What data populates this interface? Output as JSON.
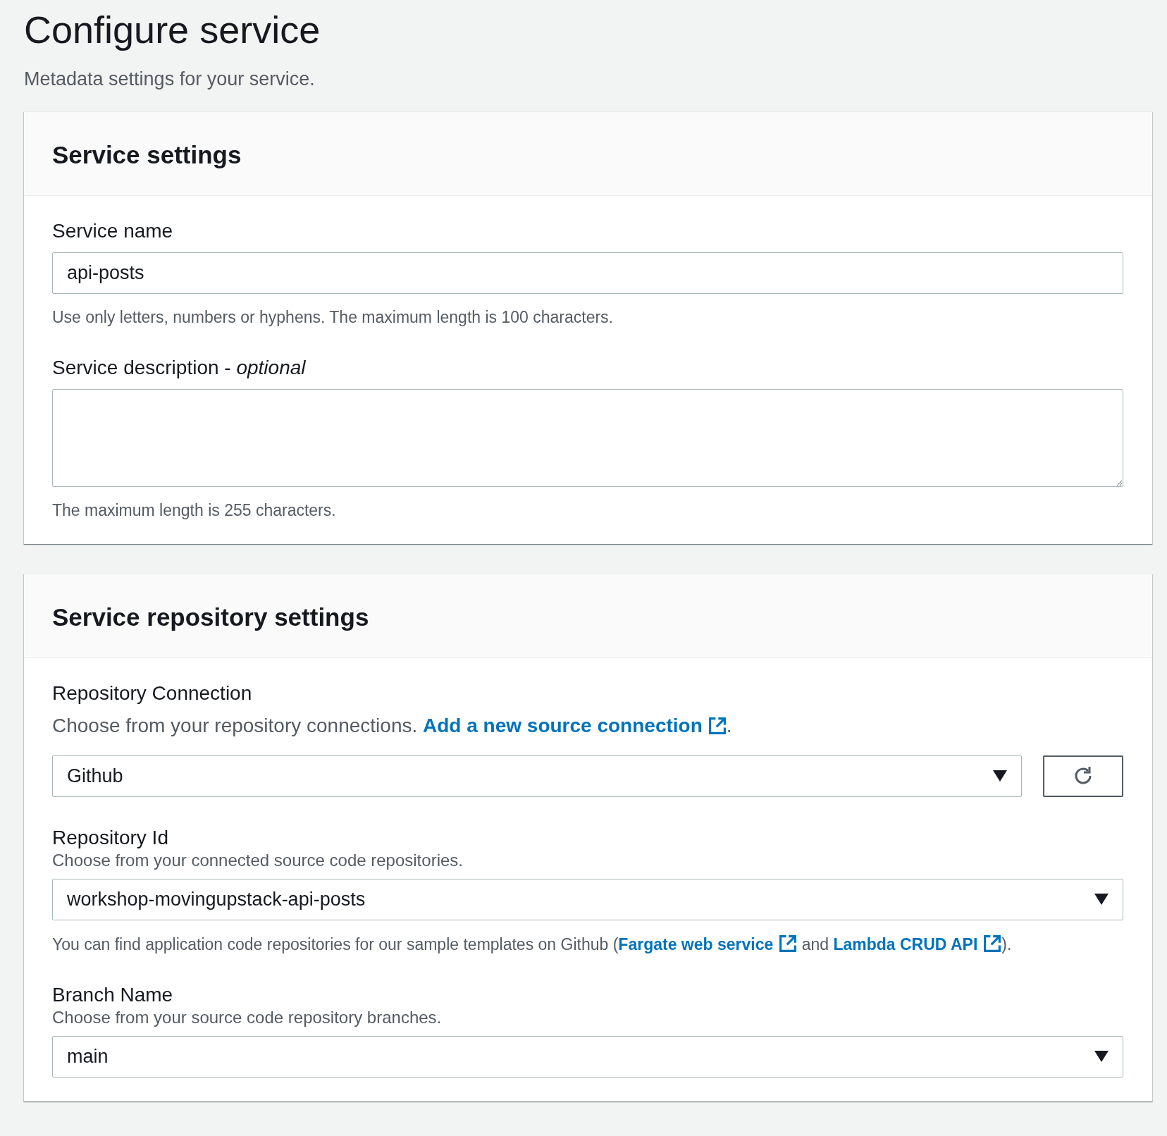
{
  "page": {
    "title": "Configure service",
    "description": "Metadata settings for your service."
  },
  "panels": [
    {
      "title": "Service settings",
      "fields": [
        {
          "kind": "text",
          "label": "Service name",
          "value": "api-posts",
          "hint": [
            {
              "text": "Use only letters, numbers or hyphens. The maximum length is 100 characters."
            }
          ]
        },
        {
          "kind": "textarea",
          "label": "Service description -",
          "label_suffix": "optional",
          "hint": [
            {
              "text": "The maximum length is 255 characters."
            }
          ]
        }
      ]
    },
    {
      "title": "Service repository settings",
      "fields": [
        {
          "kind": "select",
          "label": "Repository Connection",
          "description": [
            {
              "text": "Choose from your repository connections. "
            },
            {
              "text": "Add a new source connection",
              "link": true
            },
            {
              "text": "."
            }
          ],
          "value": "Github",
          "refresh": true
        },
        {
          "kind": "select",
          "label": "Repository Id",
          "description": [
            {
              "text": "Choose from your connected source code repositories."
            }
          ],
          "value": "workshop-movingupstack-api-posts",
          "hint": [
            {
              "text": "You can find application code repositories for our sample templates on Github ("
            },
            {
              "text": "Fargate web service",
              "link": true
            },
            {
              "text": " and "
            },
            {
              "text": "Lambda CRUD API",
              "link": true
            },
            {
              "text": ")."
            }
          ]
        },
        {
          "kind": "select",
          "label": "Branch Name",
          "description": [
            {
              "text": "Choose from your source code repository branches."
            }
          ],
          "value": "main"
        }
      ]
    }
  ]
}
